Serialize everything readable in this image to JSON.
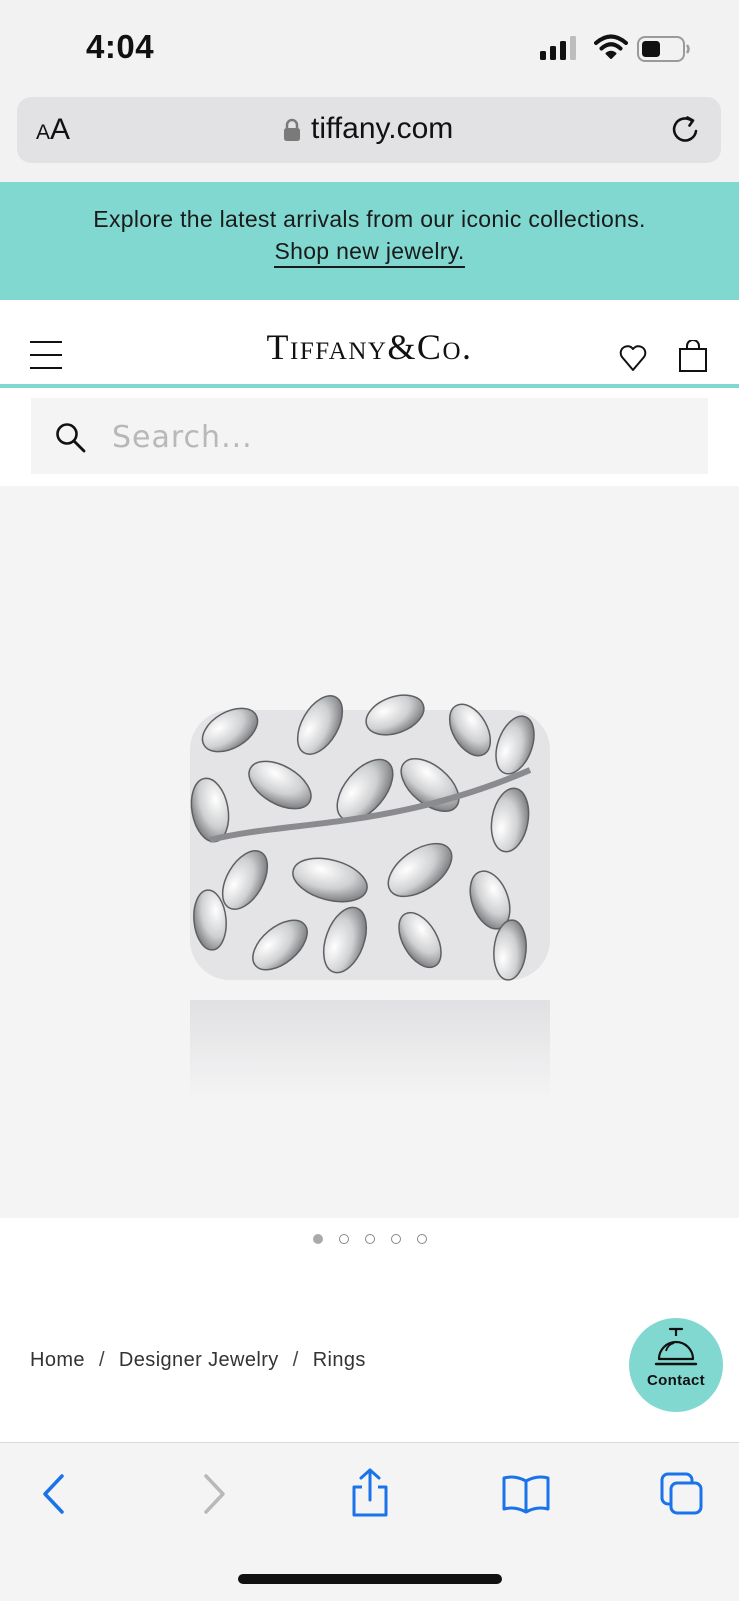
{
  "status_bar": {
    "time": "4:04",
    "icons": [
      "cellular-signal-icon",
      "wifi-icon",
      "battery-icon"
    ]
  },
  "browser": {
    "text_size_small": "A",
    "text_size_large": "A",
    "url": "tiffany.com",
    "icons": [
      "lock-icon",
      "reload-icon"
    ]
  },
  "promo": {
    "text": "Explore the latest arrivals from our iconic collections.",
    "link": "Shop new jewelry."
  },
  "header": {
    "logo": "Tiffany&Co.",
    "icons": [
      "hamburger-menu-icon",
      "heart-icon",
      "shopping-bag-icon"
    ]
  },
  "search": {
    "placeholder": "Search..."
  },
  "product": {
    "image": "silver-leaf-ring",
    "carousel_count": 5,
    "carousel_active": 1
  },
  "breadcrumb": {
    "items": [
      "Home",
      "Designer Jewelry",
      "Rings"
    ],
    "separator": "/"
  },
  "contact": {
    "label": "Contact",
    "icon": "service-bell-icon"
  },
  "toolbar": {
    "icons": [
      "back-icon",
      "forward-icon",
      "share-icon",
      "bookmarks-icon",
      "tabs-icon"
    ]
  },
  "colors": {
    "brand_teal": "#81d8d0",
    "ios_blue": "#1a73e8",
    "background": "#f4f4f5"
  }
}
